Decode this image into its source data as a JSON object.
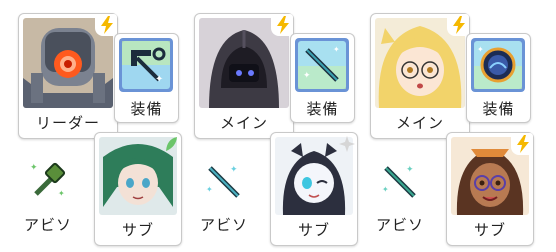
{
  "groups": [
    {
      "leader": {
        "label": "リーダー",
        "element": "electric"
      },
      "equip_label": "装備",
      "sub": {
        "label": "サブ",
        "element": "grass"
      },
      "abiso_label": "アビソ"
    },
    {
      "leader": {
        "label": "メイン",
        "element": "electric"
      },
      "equip_label": "装備",
      "sub": {
        "label": "サブ",
        "element": "light"
      },
      "abiso_label": "アビソ"
    },
    {
      "leader": {
        "label": "メイン",
        "element": "electric"
      },
      "equip_label": "装備",
      "sub": {
        "label": "サブ",
        "element": "electric"
      },
      "abiso_label": "アビソ"
    }
  ],
  "colors": {
    "electric": "#f5b800",
    "grass": "#6cc56a",
    "light": "#d6d6d6",
    "equip_frame": "#6a93d6"
  }
}
